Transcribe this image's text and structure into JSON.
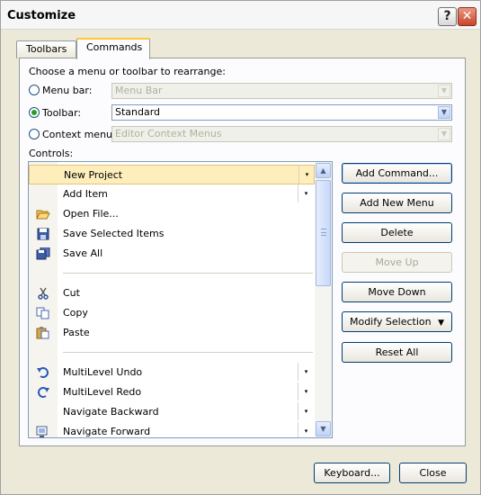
{
  "window": {
    "title": "Customize"
  },
  "titlebar": {
    "help_glyph": "?",
    "close_glyph": "✕"
  },
  "tabs": [
    {
      "label": "Toolbars"
    },
    {
      "label": "Commands"
    }
  ],
  "choose_label": "Choose a menu or toolbar to rearrange:",
  "options": {
    "menu_bar": {
      "label": "Menu bar:",
      "value": "Menu Bar",
      "selected": false,
      "enabled": false
    },
    "toolbar": {
      "label": "Toolbar:",
      "value": "Standard",
      "selected": true,
      "enabled": true
    },
    "context_menu": {
      "label": "Context menu:",
      "value": "Editor Context Menus",
      "selected": false,
      "enabled": false
    }
  },
  "controls_label": "Controls:",
  "controls": [
    {
      "label": "New Project",
      "icon": "",
      "submenu": true,
      "selected": true
    },
    {
      "label": "Add Item",
      "icon": "",
      "submenu": true
    },
    {
      "label": "Open File...",
      "icon": "open-folder-icon"
    },
    {
      "label": "Save Selected Items",
      "icon": "save-icon"
    },
    {
      "label": "Save All",
      "icon": "save-all-icon"
    },
    {
      "label": "Cut",
      "icon": "scissors-icon"
    },
    {
      "label": "Copy",
      "icon": "copy-icon"
    },
    {
      "label": "Paste",
      "icon": "paste-icon"
    },
    {
      "label": "MultiLevel Undo",
      "icon": "undo-icon",
      "submenu": true
    },
    {
      "label": "MultiLevel Redo",
      "icon": "redo-icon",
      "submenu": true
    },
    {
      "label": "Navigate Backward",
      "icon": "",
      "submenu": true
    },
    {
      "label": "Navigate Forward",
      "icon": "navigate-forward-icon",
      "submenu": true
    }
  ],
  "actions": {
    "add_command": "Add Command...",
    "add_new_menu": "Add New Menu",
    "delete": "Delete",
    "move_up": "Move Up",
    "move_down": "Move Down",
    "modify_selection": "Modify Selection",
    "reset_all": "Reset All"
  },
  "footer": {
    "keyboard": "Keyboard...",
    "close": "Close"
  },
  "glyphs": {
    "dropdown": "▼",
    "submenu": "▾",
    "scroll_up": "▲",
    "scroll_down": "▼"
  },
  "colors": {
    "selection": "#fdeebc",
    "dialog_bg": "#ece9d8",
    "radio_dot": "#21a121",
    "close_button": "#c8452a"
  }
}
